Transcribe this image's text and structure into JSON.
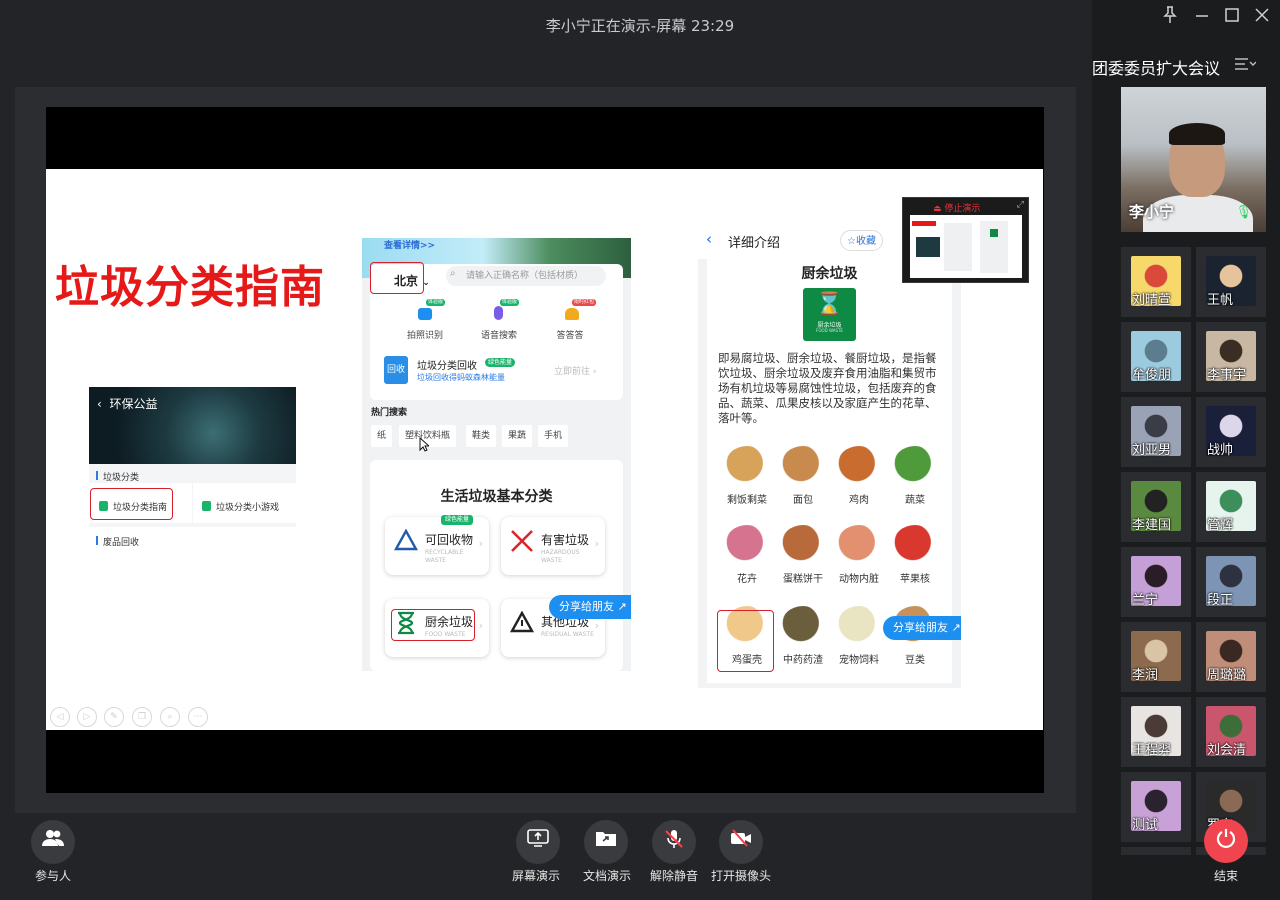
{
  "window": {
    "title": "李小宁正在演示-屏幕 23:29",
    "pin_icon": "pin-icon",
    "min_icon": "minimize-icon",
    "max_icon": "maximize-icon",
    "close_icon": "close-icon"
  },
  "meeting": {
    "name": "团委委员扩大会议",
    "speaker": "李小宁"
  },
  "participants": [
    "刘晴萱",
    "王帆",
    "牟俊朋",
    "李事宇",
    "刘亚男",
    "战帅",
    "李建国",
    "管辉",
    "兰宁",
    "段正",
    "李润",
    "周璐璐",
    "王程羿",
    "刘会清",
    "测试",
    "罗京"
  ],
  "slide": {
    "title": "垃圾分类指南",
    "phone1": {
      "back": "环保公益",
      "section1": "垃圾分类",
      "btn_guide": "垃圾分类指南",
      "btn_game": "垃圾分类小游戏",
      "section2": "废品回收"
    },
    "phone2": {
      "banner": "查看详情>>",
      "city": "北京",
      "search_placeholder": "请输入正确名称（包括材质）",
      "features": [
        {
          "label": "拍照识别",
          "badge": "体验版"
        },
        {
          "label": "语音搜索",
          "badge": "体验版"
        },
        {
          "label": "答答答",
          "badge": "限时红包"
        }
      ],
      "recycle_icon": "回收",
      "recycle_title": "垃圾分类回收",
      "recycle_badge": "绿色能量",
      "recycle_sub": "垃圾回收得蚂蚁森林能量",
      "recycle_go": "立即前往",
      "hot_title": "热门搜索",
      "hot": [
        "纸",
        "塑料饮料瓶",
        "鞋类",
        "果蔬",
        "手机"
      ],
      "basic_title": "生活垃圾基本分类",
      "green_badge": "绿色能量",
      "categories": [
        {
          "name": "可回收物",
          "en": "RECYCLABLE WASTE"
        },
        {
          "name": "有害垃圾",
          "en": "HAZARDOUS WASTE"
        },
        {
          "name": "厨余垃圾",
          "en": "FOOD WASTE"
        },
        {
          "name": "其他垃圾",
          "en": "RESIDUAL WASTE"
        }
      ],
      "share": "分享给朋友"
    },
    "phone3": {
      "header": "详细介绍",
      "fav": "收藏",
      "title": "厨余垃圾",
      "logo_cn": "厨余垃圾",
      "logo_en": "FOOD WASTE",
      "desc": "即易腐垃圾、厨余垃圾、餐厨垃圾，是指餐饮垃圾、厨余垃圾及废弃食用油脂和集贸市场有机垃圾等易腐蚀性垃圾，包括废弃的食品、蔬菜、瓜果皮核以及家庭产生的花草、落叶等。",
      "items": [
        "剩饭剩菜",
        "面包",
        "鸡肉",
        "蔬菜",
        "花卉",
        "蛋糕饼干",
        "动物内脏",
        "苹果核",
        "鸡蛋壳",
        "中药药渣",
        "宠物饲料",
        "豆类"
      ],
      "share": "分享给朋友"
    }
  },
  "preview": {
    "stop": "停止演示"
  },
  "toolbar": {
    "participants": "参与人",
    "screen_share": "屏幕演示",
    "doc_share": "文档演示",
    "unmute": "解除静音",
    "camera": "打开摄像头",
    "end": "结束"
  }
}
